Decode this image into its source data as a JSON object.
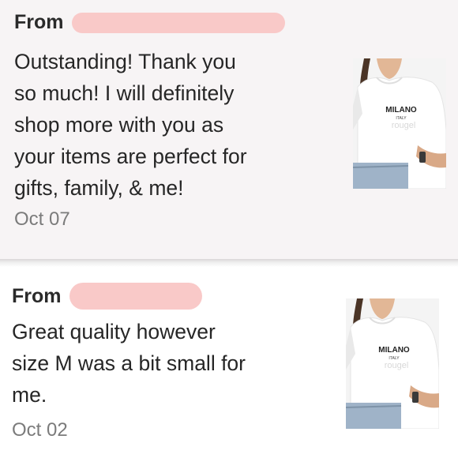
{
  "reviews": [
    {
      "from_label": "From",
      "text": "Outstanding! Thank you\nso much! I will definitely\nshop more with you as\nyour items are perfect for\ngifts, family, & me!",
      "date": "Oct 07",
      "thumbnail": {
        "icon": "tshirt-product-photo",
        "print_title": "MILANO",
        "print_subtitle": "ITALY",
        "watermark": "rougel"
      }
    },
    {
      "from_label": "From",
      "text": "Great quality however\nsize M was a bit small for\nme.",
      "date": "Oct 02",
      "thumbnail": {
        "icon": "tshirt-product-photo",
        "print_title": "MILANO",
        "print_subtitle": "ITALY",
        "watermark": "rougel"
      }
    }
  ],
  "colors": {
    "redaction": "#f9c9c8",
    "review_bg": "#f7f4f5",
    "date_text": "#7b7b7b"
  }
}
